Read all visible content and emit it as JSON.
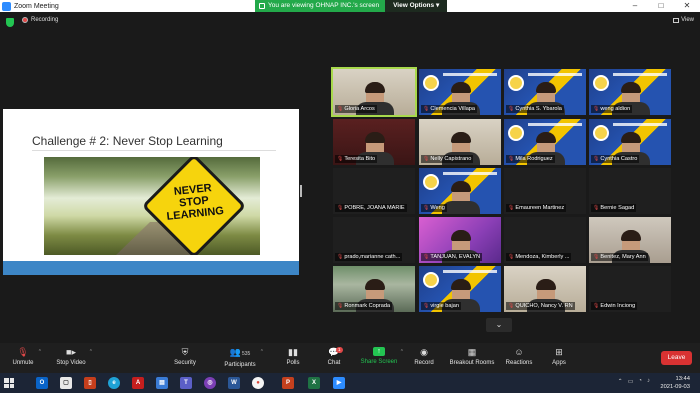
{
  "window": {
    "title": "Zoom Meeting",
    "share_banner": "You are viewing OHNAP INC.'s screen",
    "view_options": "View Options"
  },
  "top_row": {
    "recording": "Recording",
    "view": "View"
  },
  "slide": {
    "title": "Challenge # 2: Never Stop Learning",
    "sign_text": "NEVER STOP LEARNING"
  },
  "participants": [
    {
      "name": "Gloria Arcos",
      "muted": true,
      "background": "room",
      "active_speaker": true
    },
    {
      "name": "Clemencia Villapa",
      "muted": true,
      "background": "banner"
    },
    {
      "name": "Cynthia S. Ybarola",
      "muted": true,
      "background": "banner"
    },
    {
      "name": "weng aldion",
      "muted": true,
      "background": "banner"
    },
    {
      "name": "Teresita Bito",
      "muted": true,
      "background": "redroom"
    },
    {
      "name": "Nelly Capistrano",
      "muted": true,
      "background": "room"
    },
    {
      "name": "Mila Rodriguez",
      "muted": true,
      "background": "banner"
    },
    {
      "name": "Cynthia Castro",
      "muted": true,
      "background": "banner"
    },
    {
      "name": "POBRE, JOANA MARIE",
      "muted": true,
      "background": "dark"
    },
    {
      "name": "Weng",
      "muted": true,
      "background": "banner"
    },
    {
      "name": "Emaureen Martinez",
      "muted": true,
      "background": "dark"
    },
    {
      "name": "Bernie Sagad",
      "muted": true,
      "background": "dark"
    },
    {
      "name": "prado,marianne cath...",
      "muted": true,
      "background": "dark"
    },
    {
      "name": "TANJUAN, EVALYN",
      "muted": true,
      "background": "pink"
    },
    {
      "name": "Mendoza, Kimberly ...",
      "muted": true,
      "background": "dark"
    },
    {
      "name": "Benitez, Mary Ann",
      "muted": true,
      "background": "wall"
    },
    {
      "name": "Ronmark Coprada",
      "muted": true,
      "background": "street"
    },
    {
      "name": "virgie bajan",
      "muted": true,
      "background": "banner"
    },
    {
      "name": "QUICHO, Nancy V. RN",
      "muted": true,
      "background": "room"
    },
    {
      "name": "Edwin Inciong",
      "muted": true,
      "background": "dark"
    }
  ],
  "toolbar": {
    "unmute": "Unmute",
    "stop_video": "Stop Video",
    "security": "Security",
    "participants": "Participants",
    "participants_count": "535",
    "polls": "Polls",
    "chat": "Chat",
    "chat_badge": "1",
    "share_screen": "Share Screen",
    "record": "Record",
    "breakout_rooms": "Breakout Rooms",
    "reactions": "Reactions",
    "apps": "Apps",
    "leave": "Leave"
  },
  "taskbar": {
    "time": "13:44",
    "date": "2021-09-03"
  },
  "colors": {
    "share_green": "#23a94a",
    "leave_red": "#d83232",
    "active_speaker": "#a8d94c"
  }
}
